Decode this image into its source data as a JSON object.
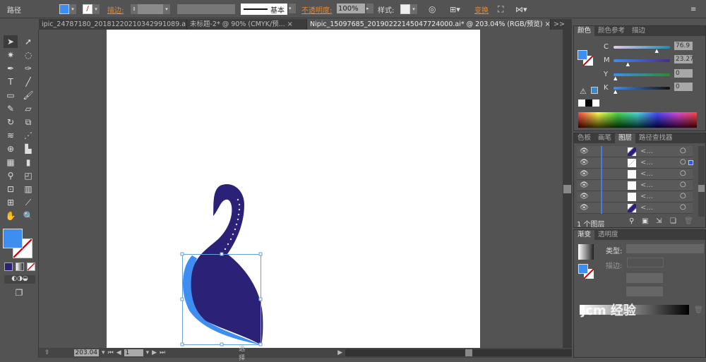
{
  "control_bar": {
    "object_type": "路径",
    "stroke_label": "描边:",
    "stroke_style": "基本",
    "opacity_label": "不透明度:",
    "opacity_value": "100%",
    "style_label": "样式:",
    "transform_label": "变换",
    "fill_color": "#3d8ef0"
  },
  "document_tabs": [
    {
      "label": "ipic_24787180_20181220210342991089.ai*",
      "close": "×",
      "active": false
    },
    {
      "label": "未标题-2* @ 90% (CMYK/预...",
      "close": "×",
      "active": false
    },
    {
      "label": "Nipic_15097685_20190222145047724000.ai* @ 203.04% (RGB/预览)",
      "close": "×",
      "active": true
    }
  ],
  "tabs_overflow": ">>",
  "color_panel": {
    "tabs": [
      "颜色",
      "颜色参考",
      "描边"
    ],
    "channels": [
      {
        "label": "C",
        "value": "76.9",
        "percent": 76.9,
        "color": "#1f6f9a"
      },
      {
        "label": "M",
        "value": "23.27",
        "percent": 23.27,
        "color": "#4a2a8a"
      },
      {
        "label": "Y",
        "value": "0",
        "percent": 0,
        "color": "#2f8a2f"
      },
      {
        "label": "K",
        "value": "0",
        "percent": 0,
        "color": "#111111"
      }
    ],
    "unit": "%"
  },
  "layers_panel": {
    "tabs": [
      "色板",
      "画笔",
      "图层",
      "路径查找器"
    ],
    "rows": [
      {
        "name": "<...",
        "thumb": "swan-dark"
      },
      {
        "name": "<...",
        "thumb": "stroke-light",
        "selected": true
      },
      {
        "name": "<...",
        "thumb": "blank"
      },
      {
        "name": "<...",
        "thumb": "blank"
      },
      {
        "name": "<...",
        "thumb": "blank"
      },
      {
        "name": "<...",
        "thumb": "swan-dark"
      }
    ],
    "count_label": "1 个图层"
  },
  "gradient_panel": {
    "tabs": [
      "渐变",
      "透明度"
    ],
    "type_label": "类型:",
    "stroke_label": "描边:"
  },
  "status_bar": {
    "zoom": "203.04",
    "artboard": "1",
    "tool_label": "选择"
  },
  "watermark": "jcm 经验",
  "colors": {
    "swan_dark": "#2b2278",
    "swan_light": "#3e8ef2",
    "selection": "#6a9fd8"
  }
}
